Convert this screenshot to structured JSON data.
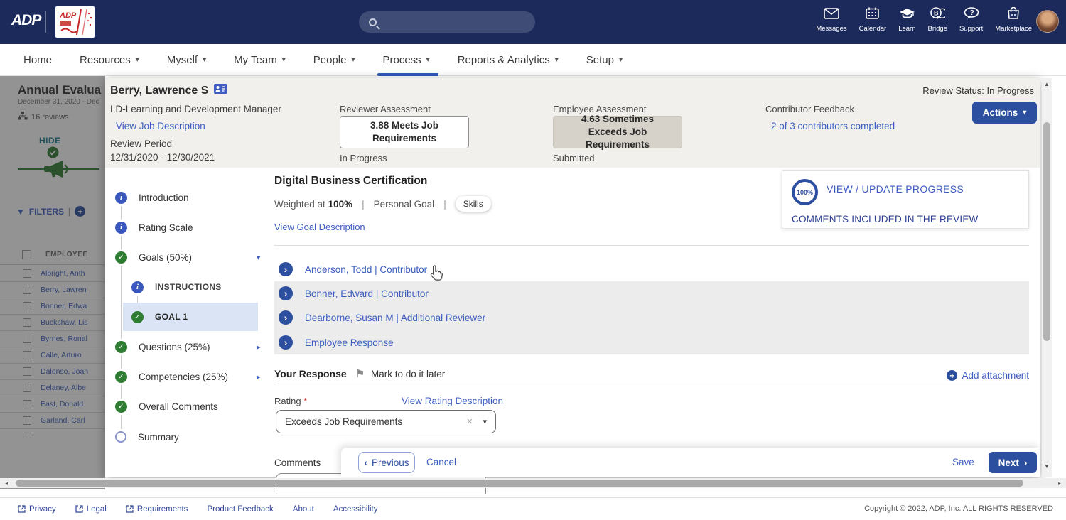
{
  "icons": {
    "caret_down": "▾",
    "caret_right": "▸",
    "chevron_right": "›",
    "chevron_left": "‹",
    "close": "✕",
    "check": "✓",
    "info": "i",
    "plus": "+",
    "flag": "⚑",
    "filter": "▼",
    "scroll_up": "▲",
    "scroll_down": "▼",
    "scroll_left": "◂",
    "scroll_right": "▸",
    "required": "*",
    "pipe": "|"
  },
  "header": {
    "brand": "ADP",
    "icons": [
      {
        "label": "Messages"
      },
      {
        "label": "Calendar"
      },
      {
        "label": "Learn"
      },
      {
        "label": "Bridge"
      },
      {
        "label": "Support"
      },
      {
        "label": "Marketplace"
      }
    ]
  },
  "nav": {
    "items": [
      {
        "label": "Home"
      },
      {
        "label": "Resources"
      },
      {
        "label": "Myself"
      },
      {
        "label": "My Team"
      },
      {
        "label": "People"
      },
      {
        "label": "Process"
      },
      {
        "label": "Reports & Analytics"
      },
      {
        "label": "Setup"
      }
    ]
  },
  "background_panel": {
    "title": "Annual Evalua",
    "date_range": "December 31, 2020 - Dec",
    "reviews_count": "16 reviews",
    "hide_label": "HIDE",
    "filters_label": "FILTERS",
    "employee_column": "EMPLOYEE",
    "employees": [
      "Albright, Anth",
      "Berry, Lawren",
      "Bonner, Edwa",
      "Buckshaw, Lis",
      "Byrnes, Ronal",
      "Calle, Arturo",
      "Dalonso, Joan",
      "Delaney, Albe",
      "East, Donald",
      "Garland, Carl"
    ]
  },
  "review": {
    "status": "Review Status: In Progress",
    "actions_label": "Actions",
    "employee_name": "Berry, Lawrence S",
    "job_title": "LD-Learning and Development Manager",
    "view_job_link": "View Job Description",
    "review_period_label": "Review Period",
    "review_period": "12/31/2020 - 12/30/2021",
    "reviewer_assessment": {
      "label": "Reviewer Assessment",
      "score": "3.88 Meets Job Requirements",
      "status": "In Progress"
    },
    "employee_assessment": {
      "label": "Employee Assessment",
      "score": "4.63 Sometimes Exceeds Job Requirements",
      "status": "Submitted"
    },
    "contributor_feedback": {
      "label": "Contributor Feedback",
      "link": "2 of 3 contributors completed"
    }
  },
  "steps": [
    {
      "label": "Introduction"
    },
    {
      "label": "Rating Scale"
    },
    {
      "label": "Goals (50%)"
    },
    {
      "label": "INSTRUCTIONS"
    },
    {
      "label": "GOAL 1"
    },
    {
      "label": "Questions (25%)"
    },
    {
      "label": "Competencies (25%)"
    },
    {
      "label": "Overall Comments"
    },
    {
      "label": "Summary"
    }
  ],
  "goal": {
    "title": "Digital Business Certification",
    "weight_label": "Weighted at",
    "weight_value": "100%",
    "type": "Personal Goal",
    "tag": "Skills",
    "view_description_link": "View Goal Description",
    "progress_percent": "100%",
    "view_update_label": "VIEW / UPDATE PROGRESS",
    "comments_included_label": "COMMENTS INCLUDED IN THE REVIEW",
    "responses": [
      "Anderson, Todd | Contributor",
      "Bonner, Edward | Contributor",
      "Dearborne, Susan M | Additional Reviewer",
      "Employee Response"
    ]
  },
  "your_response": {
    "title": "Your Response",
    "mark_later": "Mark to do it later",
    "add_attachment": "Add attachment",
    "rating_label": "Rating",
    "view_rating_link": "View Rating Description",
    "rating_value": "Exceeds Job Requirements",
    "comments_label": "Comments"
  },
  "action_bar": {
    "previous": "Previous",
    "cancel": "Cancel",
    "save": "Save",
    "next": "Next"
  },
  "footer": {
    "links": [
      {
        "label": "Privacy"
      },
      {
        "label": "Legal"
      },
      {
        "label": "Requirements"
      },
      {
        "label": "Product Feedback"
      },
      {
        "label": "About"
      },
      {
        "label": "Accessibility"
      }
    ],
    "copyright": "Copyright © 2022, ADP, Inc. ALL RIGHTS RESERVED"
  }
}
